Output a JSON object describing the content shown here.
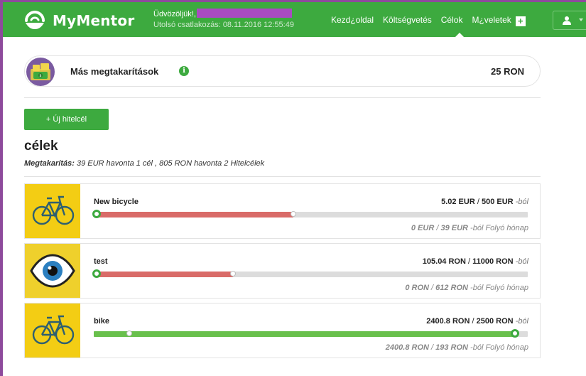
{
  "app": {
    "name": "MyMentor",
    "welcome": "Üdvözöljük!,",
    "last_login": "Utolsó csatlakozás: 08.11.2016 12:55:49"
  },
  "nav": {
    "items": [
      {
        "label": "Kezd¿oldal"
      },
      {
        "label": "Költségvetés"
      },
      {
        "label": "Célok"
      },
      {
        "label": "M¿veletek"
      }
    ],
    "add_label": "+"
  },
  "savings": {
    "label": "Más megtakarítások",
    "info_icon": "i",
    "amount": "25 RON"
  },
  "new_goal_button": "+ Új hitelcél",
  "goals_title": "célek",
  "summary": {
    "label": "Megtakarítás:",
    "text": "39 EUR havonta 1 cél , 805 RON havonta 2 Hitelcélek"
  },
  "goals": [
    {
      "name": "New bicycle",
      "icon": "bicycle-icon",
      "current": "5.02 EUR",
      "target": "500 EUR",
      "suffix": "-ból",
      "monthly_current": "0 EUR",
      "monthly_target": "39 EUR",
      "monthly_suffix": "-ból Folyó hónap",
      "progress": 0.46,
      "color": "#d96b68"
    },
    {
      "name": "test",
      "icon": "eye-icon",
      "current": "105.04 RON",
      "target": "11000 RON",
      "suffix": "-ból",
      "monthly_current": "0 RON",
      "monthly_target": "612 RON",
      "monthly_suffix": "-ból Folyó hónap",
      "progress": 0.32,
      "color": "#d96b68"
    },
    {
      "name": "bike",
      "icon": "bicycle-icon",
      "current": "2400.8 RON",
      "target": "2500 RON",
      "suffix": "-ból",
      "monthly_current": "2400.8 RON",
      "monthly_target": "193 RON",
      "monthly_suffix": "-ból Folyó hónap",
      "progress": 0.97,
      "color": "#69c04c"
    }
  ],
  "colors": {
    "brand": "#3daa3f",
    "frame": "#8e4a9c",
    "progress_red": "#d96b68",
    "progress_green": "#69c04c"
  }
}
